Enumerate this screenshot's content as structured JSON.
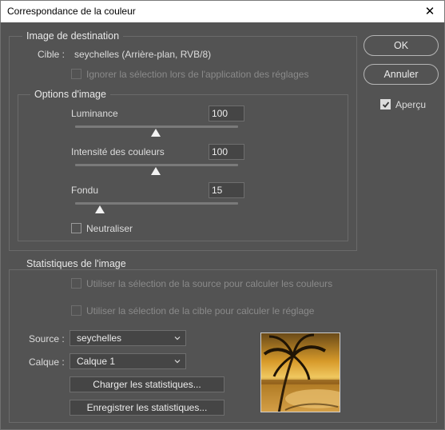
{
  "window": {
    "title": "Correspondance de la couleur",
    "close_glyph": "✕"
  },
  "destination": {
    "legend": "Image de destination",
    "target_label": "Cible :",
    "target_value": "seychelles (Arrière-plan, RVB/8)",
    "ignore_selection_label": "Ignorer la sélection lors de l'application des réglages",
    "ignore_selection_checked": false
  },
  "options": {
    "legend": "Options d'image",
    "luminance": {
      "label": "Luminance",
      "value": "100",
      "level": 50
    },
    "intensity": {
      "label": "Intensité des couleurs",
      "value": "100",
      "level": 50
    },
    "fade": {
      "label": "Fondu",
      "value": "15",
      "level": 15
    },
    "neutralize_label": "Neutraliser",
    "neutralize_checked": false
  },
  "buttons": {
    "ok": "OK",
    "cancel": "Annuler",
    "preview_label": "Aperçu",
    "preview_checked": true
  },
  "stats": {
    "legend": "Statistiques de l'image",
    "use_source_sel_label": "Utiliser la sélection de la source pour calculer les couleurs",
    "use_target_sel_label": "Utiliser la sélection de la cible pour calculer le réglage",
    "source_label": "Source :",
    "source_value": "seychelles",
    "layer_label": "Calque :",
    "layer_value": "Calque 1",
    "load_button": "Charger les statistiques...",
    "save_button": "Enregistrer les statistiques..."
  },
  "colors": {
    "background": "#535353",
    "border": "#6a6a6a",
    "text": "#dcdcdc",
    "disabled_text": "#8a8a8a"
  },
  "icons": {
    "close": "close-icon",
    "dropdown": "chevron-down-icon",
    "check": "checkmark-icon"
  }
}
